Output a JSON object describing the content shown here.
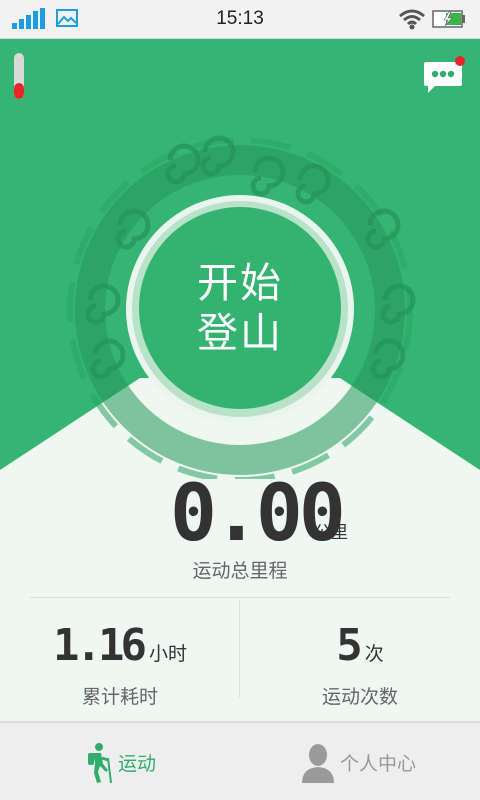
{
  "status_bar": {
    "time": "15:13",
    "icons": [
      "signal-icon",
      "gallery-icon",
      "wifi-icon",
      "battery-icon"
    ]
  },
  "hero": {
    "start_button": {
      "line1": "开始",
      "line2": "登山"
    },
    "thermometer_level": 0.35
  },
  "stats": {
    "total_distance": {
      "value": "0.00",
      "unit": "公里",
      "label": "运动总里程"
    },
    "total_time": {
      "value": "1.16",
      "unit": "小时",
      "label": "累计耗时"
    },
    "sport_count": {
      "value": "5",
      "unit": "次",
      "label": "运动次数"
    }
  },
  "bottom_nav": {
    "items": [
      {
        "label": "运动",
        "icon": "hiker-icon",
        "active": true
      },
      {
        "label": "个人中心",
        "icon": "person-icon",
        "active": false
      }
    ]
  },
  "colors": {
    "primary_green": "#2fae6a",
    "button_green": "#33b36f",
    "light_bg": "#eef7f2",
    "notification_red": "#e8262a",
    "status_blue": "#1e9ce0"
  }
}
